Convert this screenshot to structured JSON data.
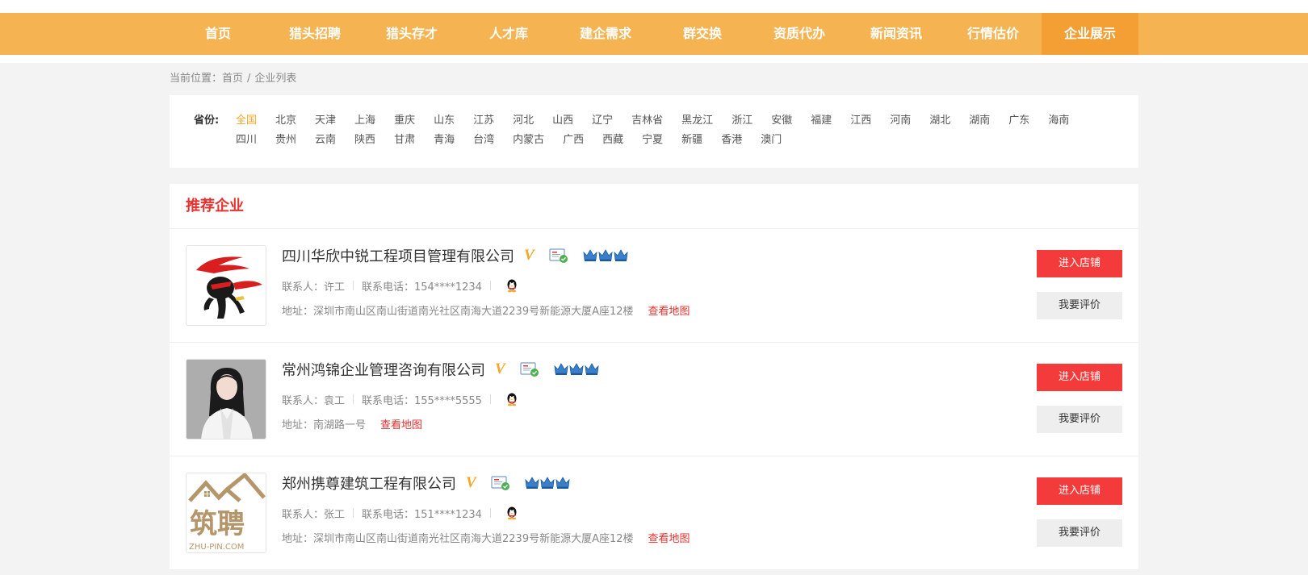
{
  "nav": {
    "items": [
      "首页",
      "猎头招聘",
      "猎头存才",
      "人才库",
      "建企需求",
      "群交换",
      "资质代办",
      "新闻资讯",
      "行情估价",
      "企业展示"
    ],
    "active_index": 9
  },
  "breadcrumb": {
    "prefix": "当前位置：",
    "home": "首页",
    "separator": "/",
    "current": "企业列表"
  },
  "filter": {
    "label": "省份:",
    "provinces": [
      "全国",
      "北京",
      "天津",
      "上海",
      "重庆",
      "山东",
      "江苏",
      "河北",
      "山西",
      "辽宁",
      "吉林省",
      "黑龙江",
      "浙江",
      "安徽",
      "福建",
      "江西",
      "河南",
      "湖北",
      "湖南",
      "广东",
      "海南",
      "四川",
      "贵州",
      "云南",
      "陕西",
      "甘肃",
      "青海",
      "台湾",
      "内蒙古",
      "广西",
      "西藏",
      "宁夏",
      "新疆",
      "香港",
      "澳门"
    ],
    "active_index": 0
  },
  "panel": {
    "title": "推荐企业"
  },
  "companies": [
    {
      "name": "四川华欣中锐工程项目管理有限公司",
      "v_badge": "V",
      "contact_label": "联系人：许工",
      "phone_label": "联系电话：154****1234",
      "address": "地址：深圳市南山区南山街道南光社区南海大道2239号新能源大厦A座12楼",
      "map_link": "查看地图",
      "enter_label": "进入店铺",
      "eval_label": "我要评价",
      "logo": "ninja-logo"
    },
    {
      "name": "常州鸿锦企业管理咨询有限公司",
      "v_badge": "V",
      "contact_label": "联系人：袁工",
      "phone_label": "联系电话：155****5555",
      "address": "地址：南湖路一号",
      "map_link": "查看地图",
      "enter_label": "进入店铺",
      "eval_label": "我要评价",
      "logo": "person-photo"
    },
    {
      "name": "郑州携尊建筑工程有限公司",
      "v_badge": "V",
      "contact_label": "联系人：张工",
      "phone_label": "联系电话：151****1234",
      "address": "地址：深圳市南山区南山街道南光社区南海大道2239号新能源大厦A座12楼",
      "map_link": "查看地图",
      "enter_label": "进入店铺",
      "eval_label": "我要评价",
      "logo": "zhupin-logo",
      "logo_text": "筑聘",
      "logo_domain": "ZHU-PIN.COM"
    }
  ],
  "colors": {
    "nav_bg": "#f5b351",
    "nav_active": "#f39f33",
    "accent_red": "#e8302f",
    "button_red": "#f33b3b",
    "v_orange": "#f5a623"
  }
}
